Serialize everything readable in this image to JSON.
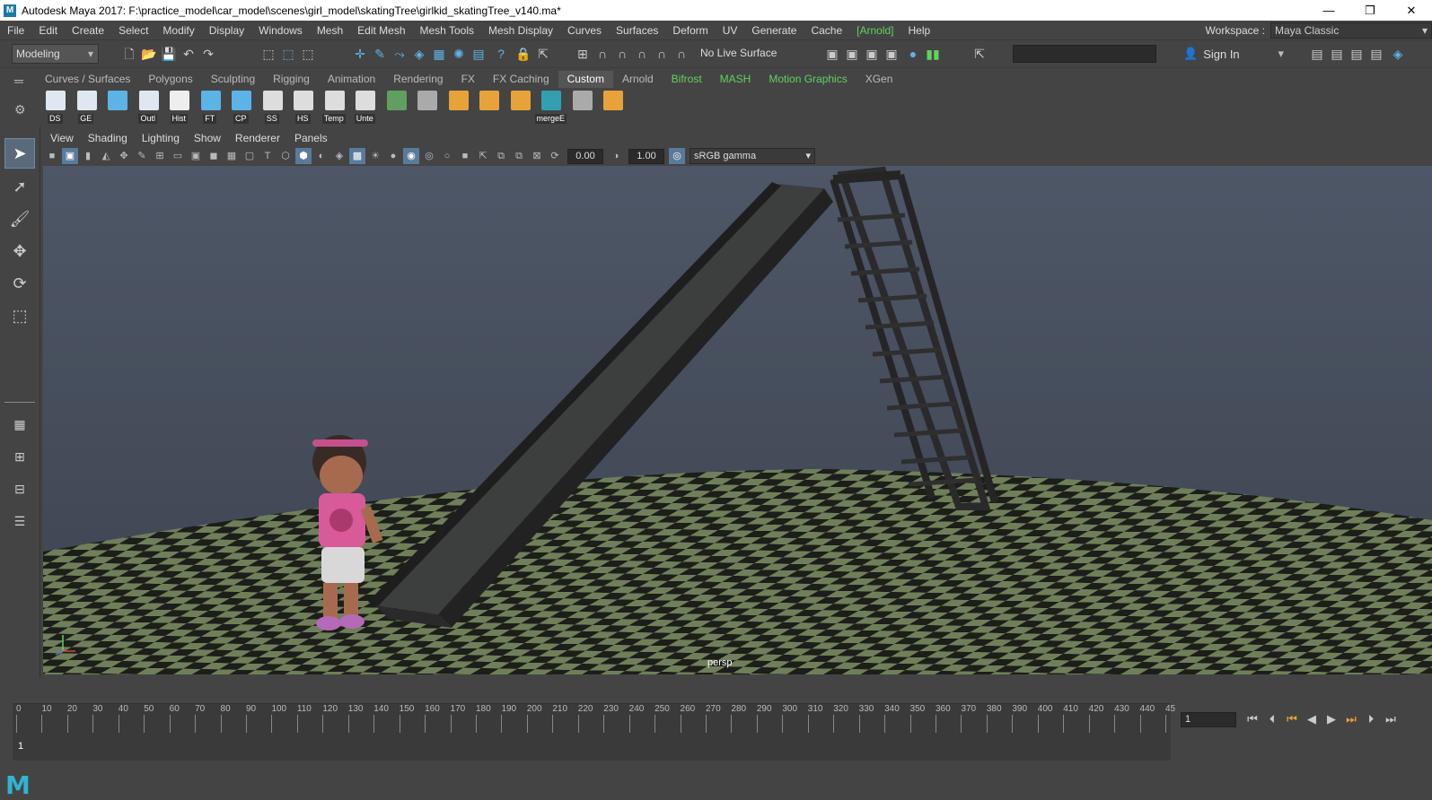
{
  "window": {
    "title": "Autodesk Maya 2017: F:\\practice_model\\car_model\\scenes\\girl_model\\skatingTree\\girlkid_skatingTree_v140.ma*",
    "logo": "M",
    "controls": [
      "—",
      "❐",
      "✕"
    ]
  },
  "menubar": {
    "items": [
      "File",
      "Edit",
      "Create",
      "Select",
      "Modify",
      "Display",
      "Windows",
      "Mesh",
      "Edit Mesh",
      "Mesh Tools",
      "Mesh Display",
      "Curves",
      "Surfaces",
      "Deform",
      "UV",
      "Generate",
      "Cache",
      "[Arnold]",
      "Help"
    ]
  },
  "workspace": {
    "label": "Workspace :",
    "value": "Maya Classic"
  },
  "statusline": {
    "mode": "Modeling",
    "live_surface": "No Live Surface",
    "sign_in": "Sign In"
  },
  "shelf": {
    "tabs": [
      "Curves / Surfaces",
      "Polygons",
      "Sculpting",
      "Rigging",
      "Animation",
      "Rendering",
      "FX",
      "FX Caching",
      "Custom",
      "Arnold",
      "Bifrost",
      "MASH",
      "Motion Graphics",
      "XGen"
    ],
    "active_tab": "Custom",
    "icons": [
      {
        "label": "DS",
        "icon": "window-icon"
      },
      {
        "label": "GE",
        "icon": "window-icon"
      },
      {
        "label": "",
        "icon": "sphere-icon"
      },
      {
        "label": "Outl",
        "icon": "outliner-icon"
      },
      {
        "label": "Hist",
        "icon": "history-icon"
      },
      {
        "label": "FT",
        "icon": "freeze-icon"
      },
      {
        "label": "CP",
        "icon": "center-pivot-icon"
      },
      {
        "label": "SS",
        "icon": "eye-icon"
      },
      {
        "label": "HS",
        "icon": "eye-icon"
      },
      {
        "label": "Temp",
        "icon": "eye-icon"
      },
      {
        "label": "Unte",
        "icon": "eye-icon"
      },
      {
        "label": "",
        "icon": "uv-grid-icon"
      },
      {
        "label": "",
        "icon": "snap-icon"
      },
      {
        "label": "",
        "icon": "extrude-icon"
      },
      {
        "label": "",
        "icon": "bevel-icon"
      },
      {
        "label": "",
        "icon": "combine-icon"
      },
      {
        "label": "mergeE",
        "icon": "merge-icon"
      },
      {
        "label": "",
        "icon": "brush-icon"
      },
      {
        "label": "",
        "icon": "pivot-icon"
      }
    ]
  },
  "panel": {
    "menus": [
      "View",
      "Shading",
      "Lighting",
      "Show",
      "Renderer",
      "Panels"
    ],
    "exposure": "0.00",
    "gamma": "1.00",
    "color_space": "sRGB gamma",
    "camera": "persp"
  },
  "timeline": {
    "ticks": [
      "0",
      "10",
      "20",
      "30",
      "40",
      "50",
      "60",
      "70",
      "80",
      "90",
      "100",
      "110",
      "120",
      "130",
      "140",
      "150",
      "160",
      "170",
      "180",
      "190",
      "200",
      "210",
      "220",
      "230",
      "240",
      "250",
      "260",
      "270",
      "280",
      "290",
      "300",
      "310",
      "320",
      "330",
      "340",
      "350",
      "360",
      "370",
      "380",
      "390",
      "400",
      "410",
      "420",
      "430",
      "440",
      "45"
    ],
    "current_frame": "1",
    "frame_field": "1"
  },
  "colors": {
    "accent": "#5cb4e6",
    "arnold": "#5fd35f",
    "checker_dark": "#1c1e19",
    "checker_light": "#6f7f5a"
  }
}
